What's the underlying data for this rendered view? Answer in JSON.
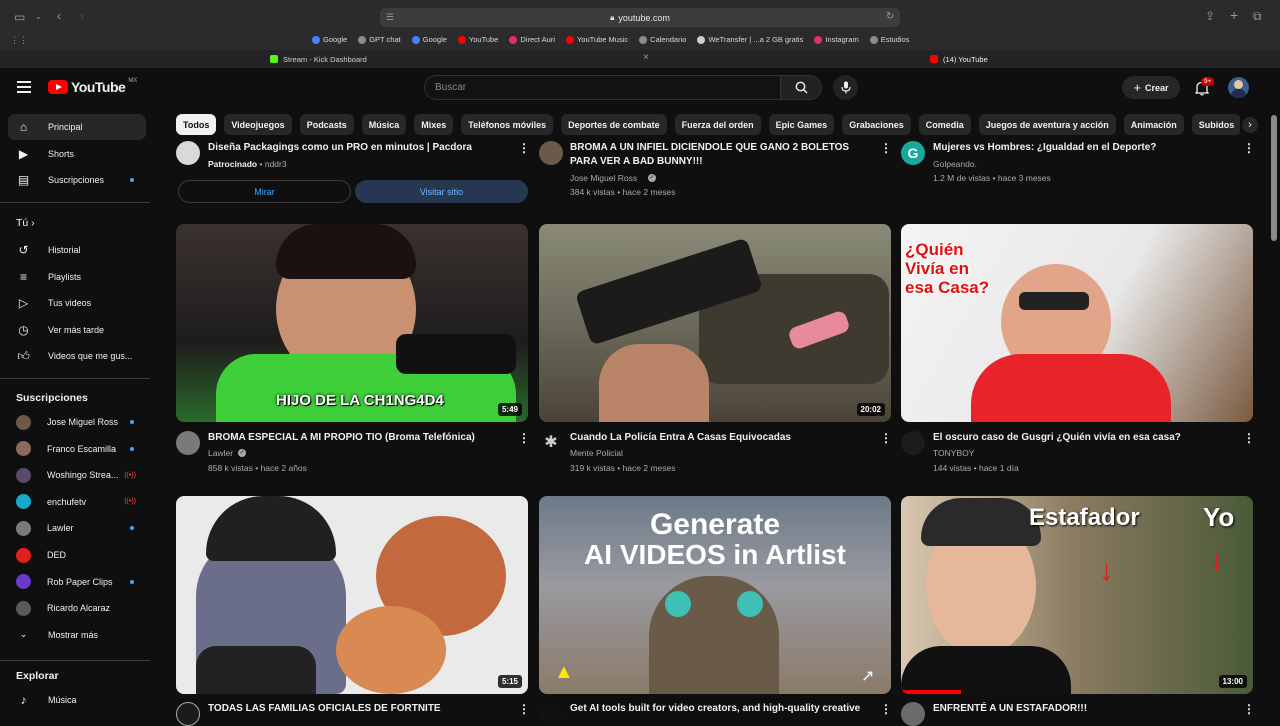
{
  "browser": {
    "url": "youtube.com",
    "bookmarks": [
      {
        "label": "Google",
        "color": "#4285f4"
      },
      {
        "label": "GPT chat",
        "color": "#8a8a8a"
      },
      {
        "label": "Google",
        "color": "#4285f4"
      },
      {
        "label": "YouTube",
        "color": "#ff0000"
      },
      {
        "label": "Direct Auri",
        "color": "#e1306c"
      },
      {
        "label": "YouTube Music",
        "color": "#ff0000"
      },
      {
        "label": "Calendario",
        "color": "#8a8a8a"
      },
      {
        "label": "WeTransfer | ...a 2 GB gratis",
        "color": "#d0d0d0"
      },
      {
        "label": "Instagram",
        "color": "#e1306c"
      },
      {
        "label": "Estudios",
        "color": "#8a8a8a"
      }
    ],
    "tabs": [
      {
        "label": "Stream - Kick Dashboard"
      },
      {
        "label": "(14) YouTube"
      }
    ]
  },
  "header": {
    "logo_text": "YouTube",
    "region": "MX",
    "search_placeholder": "Buscar",
    "create_label": "Crear",
    "notif_count": "9+"
  },
  "chips": [
    "Todos",
    "Videojuegos",
    "Podcasts",
    "Música",
    "Mixes",
    "Teléfonos móviles",
    "Deportes de combate",
    "Fuerza del orden",
    "Epic Games",
    "Grabaciones",
    "Comedia",
    "Juegos de aventura y acción",
    "Animación",
    "Subidos"
  ],
  "sidebar": {
    "main": [
      {
        "label": "Principal",
        "icon": "home-icon"
      },
      {
        "label": "Shorts",
        "icon": "shorts-icon"
      },
      {
        "label": "Suscripciones",
        "icon": "subscriptions-icon"
      }
    ],
    "you_heading": "Tú",
    "you_items": [
      {
        "label": "Historial",
        "icon": "history-icon"
      },
      {
        "label": "Playlists",
        "icon": "playlists-icon"
      },
      {
        "label": "Tus videos",
        "icon": "your-videos-icon"
      },
      {
        "label": "Ver más tarde",
        "icon": "watch-later-icon"
      },
      {
        "label": "Videos que me gus...",
        "icon": "liked-icon"
      }
    ],
    "subs_heading": "Suscripciones",
    "subs": [
      {
        "label": "Jose Miguel Ross",
        "color": "#6b5a4a"
      },
      {
        "label": "Franco Escamilla",
        "color": "#8a6a5a"
      },
      {
        "label": "Woshingo Strea...",
        "color": "#5a4a6a"
      },
      {
        "label": "enchufetv",
        "color": "#1aa6c9"
      },
      {
        "label": "Lawler",
        "color": "#7a7a7a"
      },
      {
        "label": "DED",
        "color": "#e0201b"
      },
      {
        "label": "Rob Paper Clips",
        "color": "#6a3ac9"
      },
      {
        "label": "Ricardo Alcaraz",
        "color": "#5a5a5a"
      }
    ],
    "show_more": "Mostrar más",
    "explore_heading": "Explorar",
    "explore_items": [
      {
        "label": "Música",
        "icon": "music-icon"
      }
    ]
  },
  "top_row": [
    {
      "title": "Diseña Packagings como un PRO en minutos | Pacdora",
      "sponsored": "Patrocinado",
      "channel": "nddr3",
      "btn1": "Mirar",
      "btn2": "Visitar sitio"
    },
    {
      "title": "BROMA A UN INFIEL DICIENDOLE QUE GANO 2 BOLETOS PARA VER A BAD BUNNY!!!",
      "channel": "Jose Miguel Ross",
      "stats": "384 k vistas • hace 2 meses"
    },
    {
      "title": "Mujeres vs Hombres: ¿Igualdad en el Deporte?",
      "channel": "Golpeando.",
      "stats": "1.2 M de vistas • hace 3 meses"
    }
  ],
  "mid_row": [
    {
      "title": "BROMA ESPECIAL A MI PROPIO TIO (Broma Telefónica)",
      "channel": "Lawler",
      "stats": "858 k vistas • hace 2 años",
      "duration": "5:49",
      "overlay": "HIJO DE LA CH1NG4D4"
    },
    {
      "title": "Cuando La Policía Entra A Casas Equivocadas",
      "channel": "Mente Policial",
      "stats": "319 k vistas • hace 2 meses",
      "duration": "20:02"
    },
    {
      "title": "El oscuro caso de Gusgri ¿Quién vivía en esa casa?",
      "channel": "TONYBOY",
      "stats": "144 vistas • hace 1 día",
      "duration": "",
      "overlay": "¿Quién Vivía en esa Casa?"
    }
  ],
  "bot_row": [
    {
      "title": "TODAS LAS FAMILIAS OFICIALES DE FORTNITE",
      "duration": "5:15"
    },
    {
      "title": "Get AI tools built for video creators, and high-quality creative",
      "overlay1": "Generate",
      "overlay2": "AI VIDEOS in Artlist"
    },
    {
      "title": "ENFRENTÉ A UN ESTAFADOR!!!",
      "duration": "13:00",
      "overlay1": "Estafador",
      "overlay2": "Yo"
    }
  ]
}
